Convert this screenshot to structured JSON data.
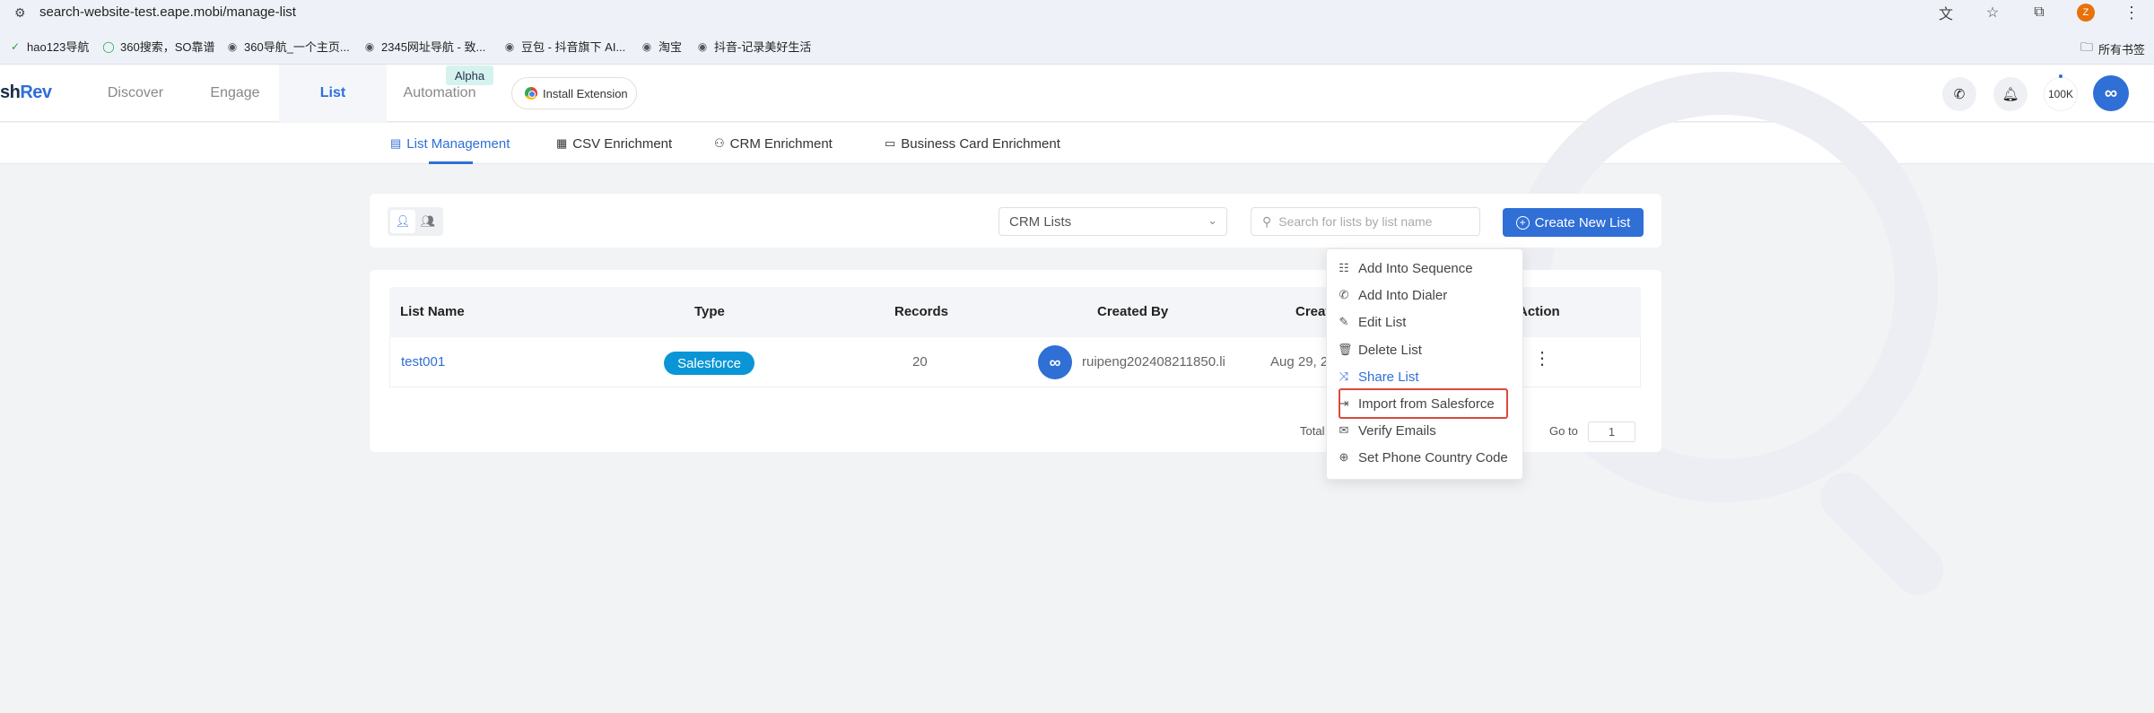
{
  "browser": {
    "url": "search-website-test.eape.mobi/manage-list",
    "profile_initial": "Z",
    "bookmarks": [
      "hao123导航",
      "360搜索，SO靠谱",
      "360导航_一个主页...",
      "2345网址导航 - 致...",
      "豆包 - 抖音旗下 AI...",
      "淘宝",
      "抖音-记录美好生活"
    ],
    "all_bookmarks": "所有书签"
  },
  "app": {
    "logo_main": "sh",
    "logo_accent": "Rev",
    "nav": [
      "Discover",
      "Engage",
      "List",
      "Automation"
    ],
    "alpha_badge": "Alpha",
    "install_label": "Install Extension",
    "credits": "100K"
  },
  "subnav": {
    "tabs": [
      "List Management",
      "CSV Enrichment",
      "CRM Enrichment",
      "Business Card Enrichment"
    ]
  },
  "toolbar": {
    "list_source": "CRM Lists",
    "search_placeholder": "Search for lists by list name",
    "create_label": "Create New List"
  },
  "table": {
    "headers": [
      "List Name",
      "Type",
      "Records",
      "Created By",
      "Creat",
      "Action"
    ],
    "rows": [
      {
        "name": "test001",
        "type": "Salesforce",
        "records": "20",
        "created_by": "ruipeng202408211850.li",
        "created": "Aug 29, 2"
      }
    ]
  },
  "pagination": {
    "total_label": "Total",
    "goto_label": "Go to",
    "goto_value": "1"
  },
  "menu": {
    "items": [
      "Add Into Sequence",
      "Add Into Dialer",
      "Edit List",
      "Delete List",
      "Share List",
      "Import from Salesforce",
      "Verify Emails",
      "Set Phone Country Code"
    ]
  },
  "colors": {
    "accent": "#2f6fd6",
    "salesforce_badge": "#0a96d6",
    "highlight": "#d94a3d"
  }
}
